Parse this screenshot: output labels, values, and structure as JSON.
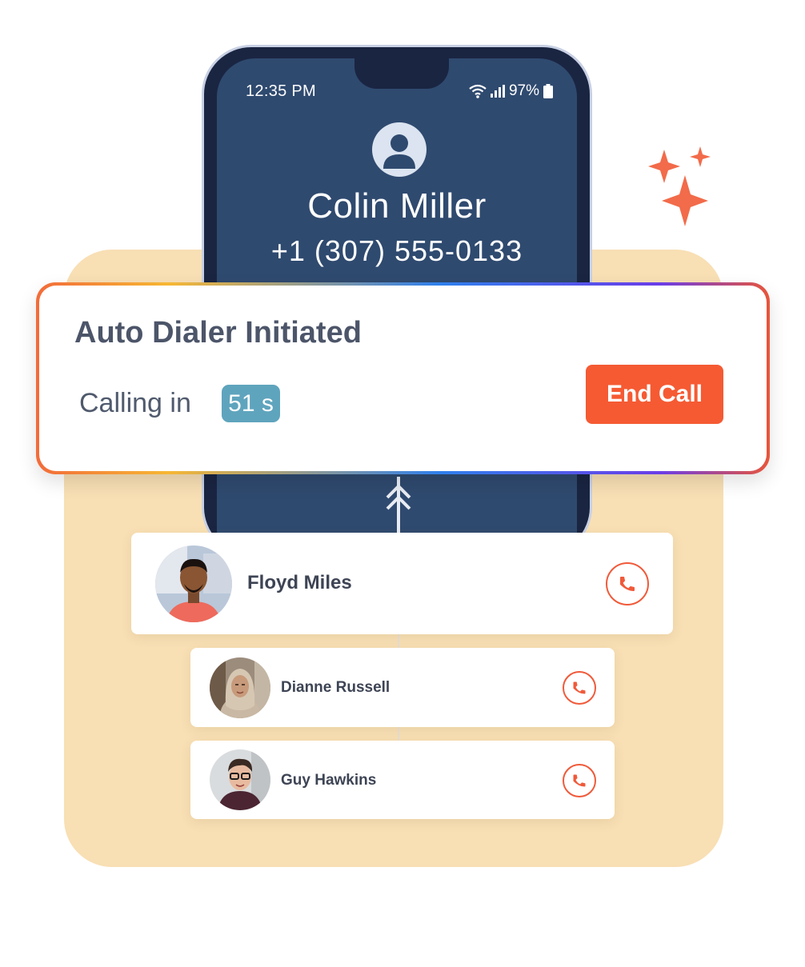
{
  "status_bar": {
    "time": "12:35 PM",
    "battery": "97%"
  },
  "caller": {
    "name": "Colin Miller",
    "number": "+1 (307) 555-0133"
  },
  "dialer_card": {
    "title": "Auto Dialer Initiated",
    "calling_label": "Calling in",
    "countdown": "51 s",
    "end_call_label": "End Call"
  },
  "contacts": [
    {
      "name": "Floyd Miles",
      "icon": "phone-icon"
    },
    {
      "name": "Dianne Russell",
      "icon": "phone-icon"
    },
    {
      "name": "Guy Hawkins",
      "icon": "phone-icon"
    }
  ],
  "colors": {
    "accent": "#f55a33",
    "phone_screen": "#2f4a6f",
    "backdrop": "#f8dfb4",
    "badge": "#5fa4bd"
  }
}
